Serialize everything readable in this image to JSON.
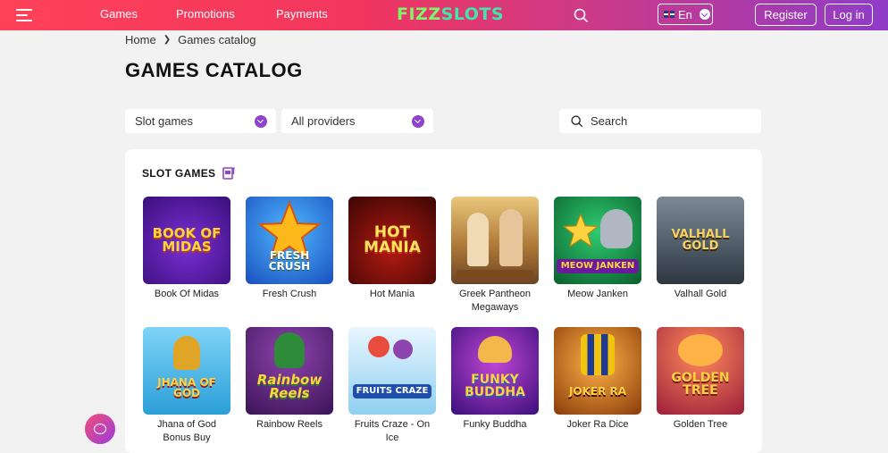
{
  "header": {
    "nav": [
      "Games",
      "Promotions",
      "Payments"
    ],
    "logo": {
      "part1": "FIZZ",
      "part2": "SLOTS"
    },
    "language": "En",
    "register_label": "Register",
    "login_label": "Log in"
  },
  "breadcrumb": {
    "home": "Home",
    "current": "Games catalog"
  },
  "page_title": "GAMES CATALOG",
  "filters": {
    "category": "Slot games",
    "provider": "All providers",
    "search_placeholder": "Search"
  },
  "section_title": "SLOT GAMES",
  "games": [
    {
      "name": "Book Of Midas",
      "art": "BOOK OF MIDAS"
    },
    {
      "name": "Fresh Crush",
      "art": "FRESH CRUSH"
    },
    {
      "name": "Hot Mania",
      "art": "HOT MANIA"
    },
    {
      "name": "Greek Pantheon Megaways",
      "art": ""
    },
    {
      "name": "Meow Janken",
      "art": "MEOW JANKEN"
    },
    {
      "name": "Valhall Gold",
      "art": "VALHALL GOLD"
    },
    {
      "name": "Jhana of God Bonus Buy",
      "art": "JHANA OF GOD"
    },
    {
      "name": "Rainbow Reels",
      "art": "Rainbow Reels"
    },
    {
      "name": "Fruits Craze - On Ice",
      "art": "FRUITS CRAZE"
    },
    {
      "name": "Funky Buddha",
      "art": "FUNKY BUDDHA"
    },
    {
      "name": "Joker Ra Dice",
      "art": "JOKER RA"
    },
    {
      "name": "Golden Tree",
      "art": "GOLDEN TREE"
    }
  ],
  "colors": {
    "accent": "#8e44ce",
    "header_start": "#ff4158",
    "header_end": "#8e3cc8"
  }
}
